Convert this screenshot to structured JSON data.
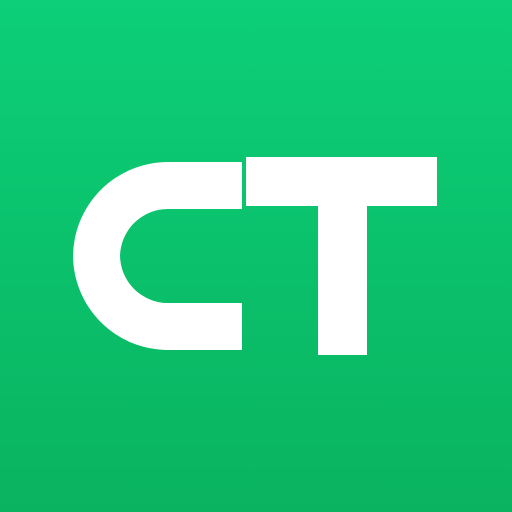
{
  "app_icon": {
    "logo_text": "CT",
    "background_color_top": "#0ccf78",
    "background_color_bottom": "#0ab35f",
    "glyph_color": "#ffffff"
  }
}
